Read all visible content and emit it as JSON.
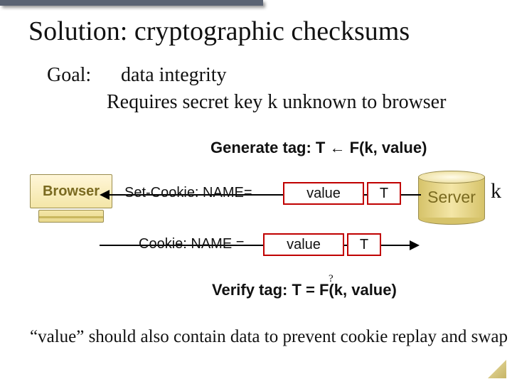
{
  "title": "Solution:    cryptographic checksums",
  "goal_label": "Goal:",
  "goal_text": "data integrity",
  "requires": "Requires secret key  k  unknown to browser",
  "generate": "Generate tag:   T ← F(k, value)",
  "verify": "Verify tag:   T = F(k, value)",
  "qmark": "?",
  "browser_label": "Browser",
  "server_label": "Server",
  "k_label": "k",
  "row1": {
    "prefix": "Set-Cookie:  NAME=",
    "value": "value",
    "tag": "T"
  },
  "row2": {
    "prefix": "Cookie:   NAME =",
    "value": "value",
    "tag": "T"
  },
  "footnote": "“value” should also contain data to prevent cookie replay and swap"
}
